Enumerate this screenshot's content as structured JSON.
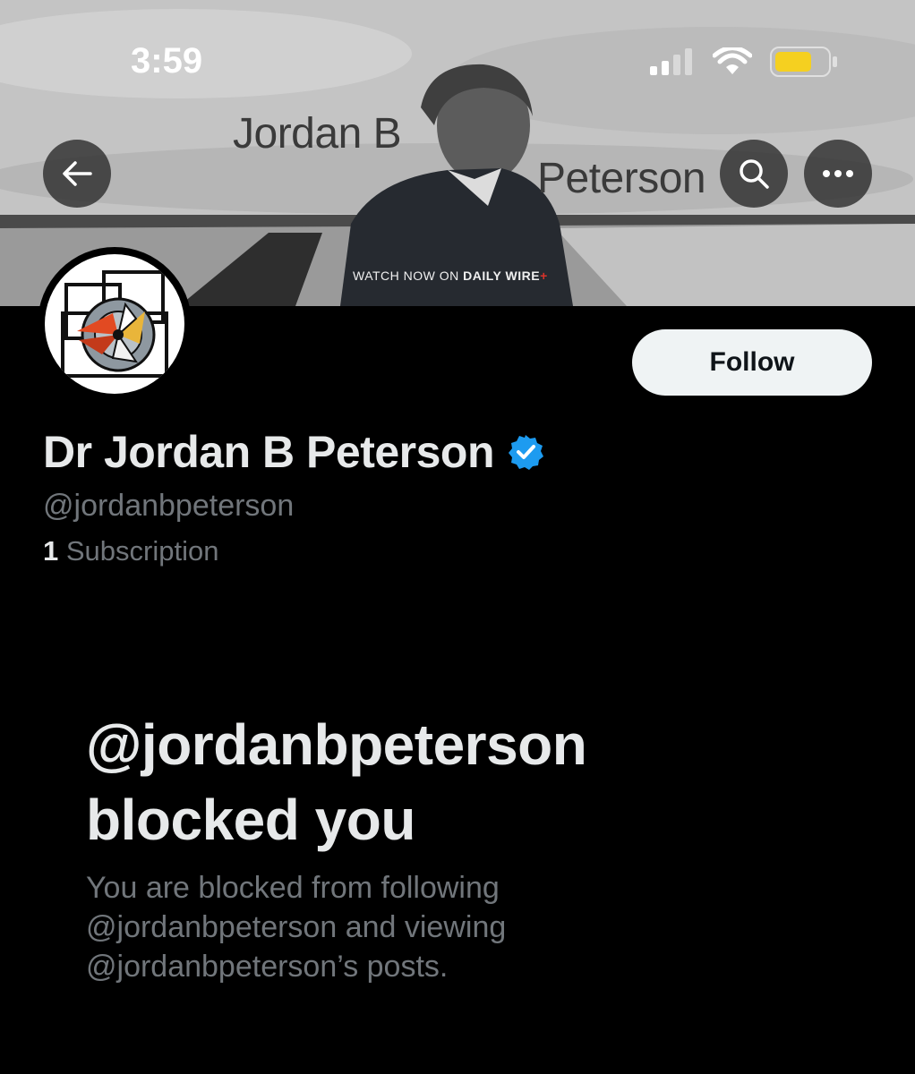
{
  "status_bar": {
    "time": "3:59",
    "icons": [
      "signal-icon",
      "wifi-icon",
      "battery-icon"
    ],
    "battery_color": "#f5d020"
  },
  "banner": {
    "text_line_1": "Jordan B",
    "text_line_2": "Peterson",
    "cta_prefix": "WATCH NOW ON ",
    "cta_brand": "DAILY WIRE",
    "cta_plus": "+",
    "cta_plus_color": "#d8332a"
  },
  "nav": {
    "back_icon": "arrow-left-icon",
    "search_icon": "search-icon",
    "more_icon": "more-horizontal-icon"
  },
  "profile": {
    "display_name": "Dr Jordan B Peterson",
    "verified_color": "#1d9bf0",
    "handle": "@jordanbpeterson",
    "subscription_count": "1",
    "subscription_label": "Subscription",
    "follow_label": "Follow"
  },
  "blocked": {
    "title_line_1": "@jordanbpeterson",
    "title_line_2": "blocked you",
    "description": "You are blocked from following @jordanbpeterson and viewing @jordanbpeterson’s posts."
  }
}
